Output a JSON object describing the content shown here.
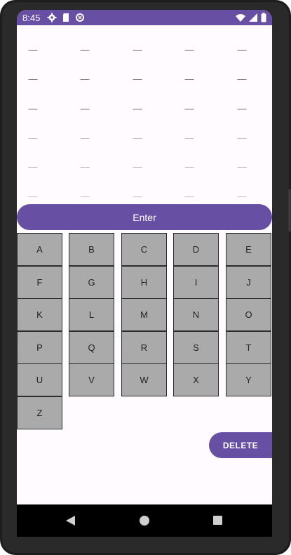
{
  "status_bar": {
    "time": "8:45",
    "left_icons": [
      "gear-icon",
      "sd-card-icon",
      "data-saver-icon"
    ],
    "right_icons": [
      "wifi-icon",
      "cell-signal-icon",
      "battery-icon"
    ],
    "background": "#6750a4"
  },
  "guess_grid": {
    "rows": [
      {
        "cells": [
          "—",
          "—",
          "—",
          "—",
          "—"
        ]
      },
      {
        "cells": [
          "—",
          "—",
          "—",
          "—",
          "—"
        ]
      },
      {
        "cells": [
          "—",
          "—",
          "—",
          "—",
          "—"
        ]
      },
      {
        "cells": [
          "—",
          "—",
          "—",
          "—",
          "—"
        ]
      },
      {
        "cells": [
          "—",
          "—",
          "—",
          "—",
          "—"
        ]
      },
      {
        "cells": [
          "—",
          "—",
          "—",
          "—",
          "—"
        ]
      }
    ]
  },
  "enter_button": {
    "label": "Enter"
  },
  "keyboard": {
    "keys": [
      "A",
      "B",
      "C",
      "D",
      "E",
      "F",
      "G",
      "H",
      "I",
      "J",
      "K",
      "L",
      "M",
      "N",
      "O",
      "P",
      "Q",
      "R",
      "S",
      "T",
      "U",
      "V",
      "W",
      "X",
      "Y",
      "Z"
    ]
  },
  "delete_button": {
    "label": "DELETE"
  },
  "nav_bar": {
    "icons": [
      "back-icon",
      "home-icon",
      "recents-icon"
    ]
  },
  "accent_color": "#6750a4"
}
